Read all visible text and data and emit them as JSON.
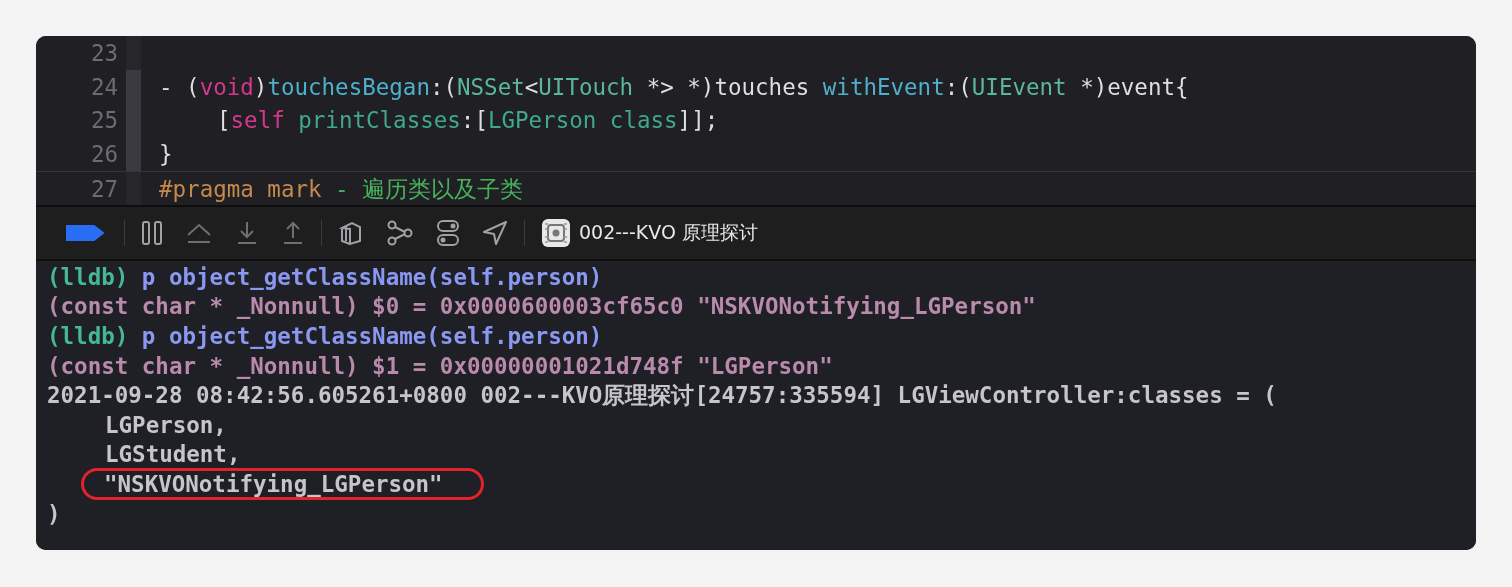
{
  "editor": {
    "lines": [
      {
        "number": "23",
        "in_fold_range": false
      },
      {
        "number": "24",
        "in_fold_range": true,
        "tokens": [
          {
            "kind": "plain",
            "text": "- ("
          },
          {
            "kind": "keyword",
            "text": "void"
          },
          {
            "kind": "plain",
            "text": ")"
          },
          {
            "kind": "declaration",
            "text": "touchesBegan"
          },
          {
            "kind": "plain",
            "text": ":("
          },
          {
            "kind": "type",
            "text": "NSSet"
          },
          {
            "kind": "plain",
            "text": "<"
          },
          {
            "kind": "type",
            "text": "UITouch"
          },
          {
            "kind": "plain",
            "text": " *> *)touches "
          },
          {
            "kind": "declaration",
            "text": "withEvent"
          },
          {
            "kind": "plain",
            "text": ":("
          },
          {
            "kind": "type",
            "text": "UIEvent"
          },
          {
            "kind": "plain",
            "text": " *)event{"
          }
        ]
      },
      {
        "number": "25",
        "in_fold_range": true,
        "indented": true,
        "tokens": [
          {
            "kind": "plain",
            "text": "["
          },
          {
            "kind": "keyword",
            "text": "self"
          },
          {
            "kind": "method",
            "text": " printClasses"
          },
          {
            "kind": "plain",
            "text": ":["
          },
          {
            "kind": "method",
            "text": "LGPerson class"
          },
          {
            "kind": "plain",
            "text": "]];"
          }
        ]
      },
      {
        "number": "26",
        "in_fold_range": true,
        "tokens": [
          {
            "kind": "plain",
            "text": "}"
          }
        ]
      },
      {
        "number": "27",
        "in_fold_range": false,
        "tokens": [
          {
            "kind": "preprocessor",
            "text": "#pragma mark"
          },
          {
            "kind": "mark",
            "text": " - 遍历类以及子类"
          }
        ]
      }
    ]
  },
  "debug_bar": {
    "breakpoints_active": true,
    "target": "002---KVO 原理探讨"
  },
  "console": {
    "lines": [
      {
        "circled": false,
        "segments": [
          {
            "kind": "prompt",
            "text": "(lldb)"
          },
          {
            "kind": "command",
            "text": " p object_getClassName(self.person)"
          }
        ]
      },
      {
        "circled": false,
        "segments": [
          {
            "kind": "result",
            "text": "(const char * _Nonnull) $0 = 0x0000600003cf65c0 \"NSKVONotifying_LGPerson\""
          }
        ]
      },
      {
        "circled": false,
        "segments": [
          {
            "kind": "prompt",
            "text": "(lldb)"
          },
          {
            "kind": "command",
            "text": " p object_getClassName(self.person)"
          }
        ]
      },
      {
        "circled": false,
        "segments": [
          {
            "kind": "result",
            "text": "(const char * _Nonnull) $1 = 0x00000001021d748f \"LGPerson\""
          }
        ]
      },
      {
        "circled": false,
        "segments": [
          {
            "kind": "log",
            "text": "2021-09-28 08:42:56.605261+0800 002---KVO原理探讨[24757:335594] LGViewController:classes = ("
          }
        ],
        "children": [
          {
            "circled": false,
            "segments": [
              {
                "kind": "log",
                "text": "LGPerson,"
              }
            ]
          },
          {
            "circled": false,
            "segments": [
              {
                "kind": "log",
                "text": "LGStudent,"
              }
            ]
          },
          {
            "circled": true,
            "segments": [
              {
                "kind": "log",
                "text": "\"NSKVONotifying_LGPerson\""
              }
            ]
          }
        ]
      },
      {
        "circled": false,
        "segments": [
          {
            "kind": "log",
            "text": ")"
          }
        ]
      }
    ]
  }
}
